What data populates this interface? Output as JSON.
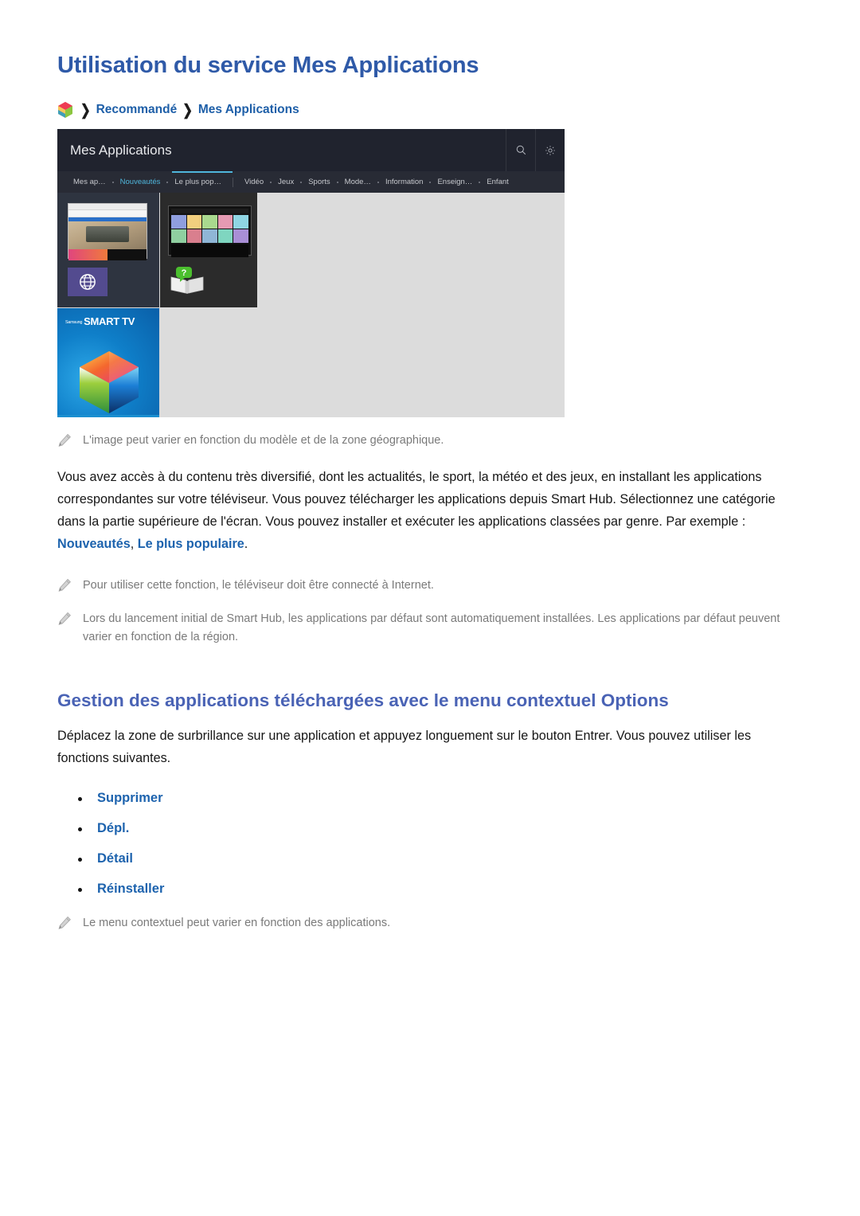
{
  "document": {
    "page_title": "Utilisation du service Mes Applications",
    "breadcrumb": {
      "icon": "smart-hub-cube-icon",
      "separator": "❯",
      "items": [
        "Recommandé",
        "Mes Applications"
      ]
    }
  },
  "tv_screenshot": {
    "header": {
      "title": "Mes Applications",
      "search_icon": "search-icon",
      "settings_icon": "gear-icon"
    },
    "nav": {
      "items": [
        {
          "label": "Mes ap…",
          "active": false
        },
        {
          "label": "Nouveautés",
          "active": true
        },
        {
          "label": "Le plus pop…",
          "active": false
        },
        {
          "label": "Vidéo",
          "active": false
        },
        {
          "label": "Jeux",
          "active": false
        },
        {
          "label": "Sports",
          "active": false
        },
        {
          "label": "Mode…",
          "active": false
        },
        {
          "label": "Information",
          "active": false
        },
        {
          "label": "Enseign…",
          "active": false
        },
        {
          "label": "Enfant",
          "active": false
        }
      ]
    },
    "tiles": [
      {
        "name": "web-browser-tile",
        "icon": "globe-icon"
      },
      {
        "name": "help-guide-tile",
        "icon": "book-question-icon"
      },
      {
        "name": "smart-tv-promo-tile",
        "logo_small": "Samsung",
        "logo_main": "SMART TV"
      }
    ]
  },
  "notes": {
    "image_variation": "L'image peut varier en fonction du modèle et de la zone géographique.",
    "internet_required": "Pour utiliser cette fonction, le téléviseur doit être connecté à Internet.",
    "default_apps": "Lors du lancement initial de Smart Hub, les applications par défaut sont automatiquement installées. Les applications par défaut peuvent varier en fonction de la région.",
    "context_menu_varies": "Le menu contextuel peut varier en fonction des applications."
  },
  "main_paragraph": {
    "part1": "Vous avez accès à du contenu très diversifié, dont les actualités, le sport, la météo et des jeux, en installant les applications correspondantes sur votre téléviseur. Vous pouvez télécharger les applications depuis Smart Hub. Sélectionnez une catégorie dans la partie supérieure de l'écran. Vous pouvez installer et exécuter les applications classées par genre. Par exemple : ",
    "highlight1": "Nouveautés",
    "separator": ", ",
    "highlight2": "Le plus populaire",
    "part2": "."
  },
  "section2": {
    "title": "Gestion des applications téléchargées avec le menu contextuel Options",
    "body": "Déplacez la zone de surbrillance sur une application et appuyez longuement sur le bouton Entrer. Vous pouvez utiliser les fonctions suivantes.",
    "options": [
      "Supprimer",
      "Dépl.",
      "Détail",
      "Réinstaller"
    ]
  },
  "colors": {
    "title_blue": "#2f5aa8",
    "link_blue": "#1d63ae",
    "section_blue": "#4a63b5",
    "note_gray": "#7a7a7a",
    "tv_header_dark": "#20232e",
    "tv_nav_dark": "#282b35",
    "tv_accent_cyan": "#4fb6dc",
    "tv_body_gray": "#dcdcdc"
  }
}
